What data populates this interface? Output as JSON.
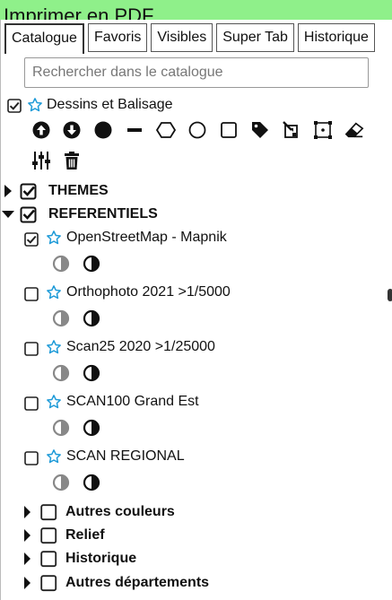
{
  "window": {
    "title": "Imprimer en PDF"
  },
  "tabs": [
    {
      "label": "Catalogue",
      "active": true
    },
    {
      "label": "Favoris",
      "active": false
    },
    {
      "label": "Visibles",
      "active": false
    },
    {
      "label": "Super Tab",
      "active": false
    },
    {
      "label": "Historique",
      "active": false
    }
  ],
  "search": {
    "placeholder": "Rechercher dans le catalogue",
    "value": ""
  },
  "drawing": {
    "label": "Dessins et Balisage",
    "checked": true,
    "tools": [
      "arrow-up-icon",
      "arrow-down-icon",
      "point-icon",
      "line-icon",
      "polygon-icon",
      "circle-icon",
      "rectangle-icon",
      "label-icon",
      "edit-icon",
      "bbox-icon",
      "eraser-icon",
      "settings-icon",
      "trash-icon"
    ]
  },
  "groups": {
    "themes": {
      "label": "THEMES",
      "checked": true,
      "expanded": false
    },
    "referentiels": {
      "label": "REFERENTIELS",
      "checked": true,
      "expanded": true
    }
  },
  "layers": [
    {
      "label": "OpenStreetMap - Mapnik",
      "checked": true
    },
    {
      "label": "Orthophoto 2021 >1/5000",
      "checked": false
    },
    {
      "label": "Scan25 2020 >1/25000",
      "checked": false
    },
    {
      "label": "SCAN100 Grand Est",
      "checked": false
    },
    {
      "label": "SCAN REGIONAL",
      "checked": false
    }
  ],
  "subgroups": [
    {
      "label": "Autres couleurs",
      "checked": false
    },
    {
      "label": "Relief",
      "checked": false
    },
    {
      "label": "Historique",
      "checked": false
    },
    {
      "label": "Autres départements",
      "checked": false
    }
  ],
  "colors": {
    "topbar": "#8ff08a",
    "star": "#1f9bd8"
  }
}
